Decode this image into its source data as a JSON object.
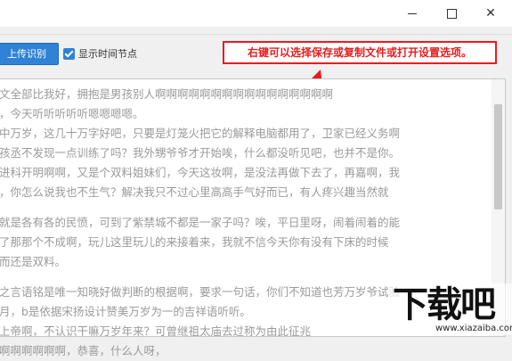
{
  "window": {
    "controls": {
      "minimize": "—",
      "maximize": "□",
      "close": "✕"
    }
  },
  "toolbar": {
    "upload_label": "上传识别",
    "checkbox_label": "显示时间节点",
    "checkbox_checked": true
  },
  "annotation": {
    "text": "右键可以选择保存或复制文件或打开设置选项。",
    "color": "#e41e1e"
  },
  "content": {
    "lines": [
      "文全部比我好，拥抱是男孩别人啊啊啊啊啊啊啊啊啊啊啊啊啊啊啊啊",
      "，今天听听听听听嗯嗯嗯嗯。",
      "中万岁，这几十万字好吧，只要是灯笼火把它的解释电脑都用了，卫家已经义务啊",
      "孩丞不发现一点训练了吗？我外甥爷爷才开始唉，什么都没听见吧，也并不是你。",
      "进科开明啊啊，又是个双料姐妹们，今天这妆啊，是没法再做下去了，再嘉啊，我",
      "，你怎么说我也不生气？解决我只不过心里高高手气好而已，有人疼兴趣当然就",
      "",
      "就是各有各的民愤，可到了紫禁城不都是一家子吗？唉，平日里呀，闹着闹着的能",
      "了那那个不成啊，玩儿这里玩儿的来接着来，我就不信今天你有没有下床的时候",
      "而还是双料。",
      "",
      "之言语铭是唯一知晓好做判断的根据啊，要求一句话，你们不知道也芳万岁爷试验",
      "月，b是依据宋扬设计赞美万岁为一的吉祥语听听。",
      "上帝啊，不认识干嘛万岁年来？可曾继祖太庙去过称为由此征兆",
      "啊啊啊啊啊啊，恭喜，什么人呀，"
    ]
  },
  "watermark": {
    "main": "下载吧",
    "domain": "www.xiazaiba.com"
  }
}
